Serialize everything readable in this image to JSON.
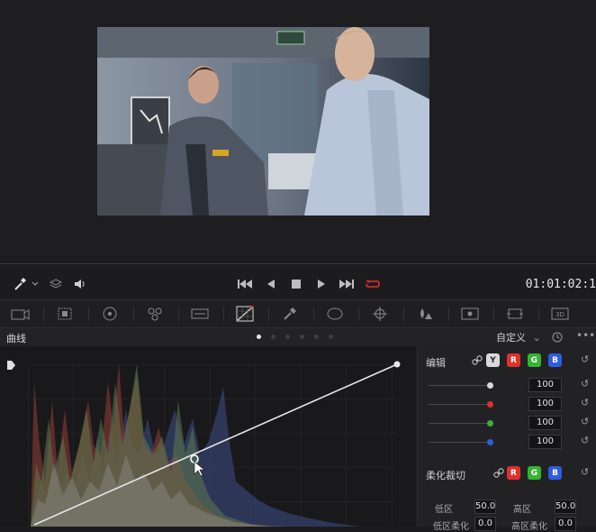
{
  "transport": {
    "timecode": "01:01:02:1"
  },
  "panel": {
    "title": "曲线",
    "mode": "自定义",
    "mode_arrow": "⌄",
    "pages": 6,
    "active_page": 0
  },
  "edit": {
    "title": "编辑",
    "channels": [
      "Y",
      "R",
      "G",
      "B"
    ],
    "rows": [
      {
        "color": "#d9d9d9",
        "value": "100",
        "level": 1.0
      },
      {
        "color": "#e0302c",
        "value": "100",
        "level": 1.0
      },
      {
        "color": "#35b335",
        "value": "100",
        "level": 1.0
      },
      {
        "color": "#2f5de0",
        "value": "100",
        "level": 1.0
      }
    ]
  },
  "soft_clip": {
    "title": "柔化裁切",
    "channels": [
      "R",
      "G",
      "B"
    ],
    "low_label": "低区",
    "low_value": "50.0",
    "high_label": "高区",
    "high_value": "50.0",
    "low_soft_label": "低区柔化",
    "low_soft_value": "0.0",
    "high_soft_label": "高区柔化",
    "high_soft_value": "0.0"
  },
  "colors": {
    "accent_red": "#e0302c",
    "accent_green": "#35b335",
    "accent_blue": "#2f5de0",
    "active_y": "#d9d9d9"
  }
}
